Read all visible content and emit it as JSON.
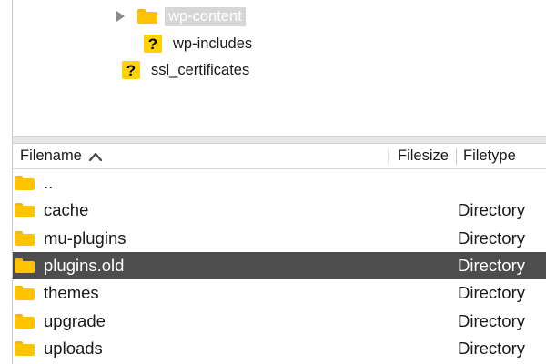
{
  "tree": {
    "items": [
      {
        "label": "wp-content",
        "icon": "folder-icon",
        "expandable": true,
        "selected": true
      },
      {
        "label": "wp-includes",
        "icon": "unknown-question-icon",
        "expandable": false,
        "selected": false
      },
      {
        "label": "ssl_certificates",
        "icon": "unknown-question-icon",
        "expandable": false,
        "selected": false
      }
    ]
  },
  "filelist": {
    "columns": {
      "filename": "Filename",
      "filesize": "Filesize",
      "filetype": "Filetype",
      "sort": "ascending"
    },
    "rows": [
      {
        "name": "..",
        "type": ""
      },
      {
        "name": "cache",
        "type": "Directory"
      },
      {
        "name": "mu-plugins",
        "type": "Directory"
      },
      {
        "name": "plugins.old",
        "type": "Directory",
        "selected": true
      },
      {
        "name": "themes",
        "type": "Directory"
      },
      {
        "name": "upgrade",
        "type": "Directory"
      },
      {
        "name": "uploads",
        "type": "Directory"
      }
    ]
  },
  "colors": {
    "folder": "#ffc400",
    "selected_row": "#4d4d4d",
    "tree_selection": "#d6d6d6"
  }
}
